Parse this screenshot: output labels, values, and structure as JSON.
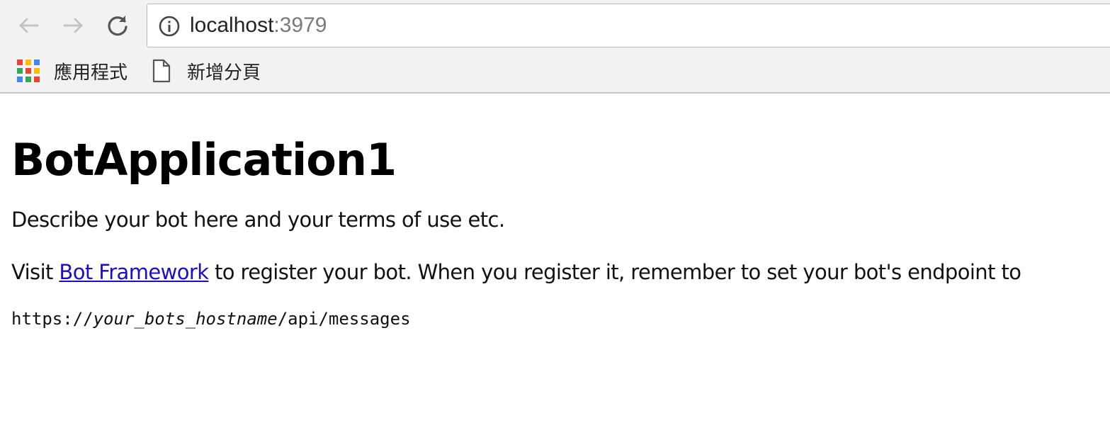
{
  "browser": {
    "back_icon": "arrow-left-icon",
    "forward_icon": "arrow-right-icon",
    "reload_icon": "reload-icon",
    "info_icon": "info-circle-icon",
    "url_host": "localhost",
    "url_port": ":3979",
    "bookmarks": [
      {
        "icon": "apps-grid-icon",
        "label": "應用程式"
      },
      {
        "icon": "page-icon",
        "label": "新增分頁"
      }
    ]
  },
  "page": {
    "title": "BotApplication1",
    "description": "Describe your bot here and your terms of use etc.",
    "visit_prefix": "Visit ",
    "link_text": "Bot Framework",
    "visit_suffix": " to register your bot. When you register it, remember to set your bot's endpoint to",
    "endpoint_prefix": "https://",
    "endpoint_variable": "your_bots_hostname",
    "endpoint_suffix": "/api/messages"
  },
  "colors": {
    "link": "#1a0dcc",
    "toolbar_bg": "#f2f2f2"
  }
}
